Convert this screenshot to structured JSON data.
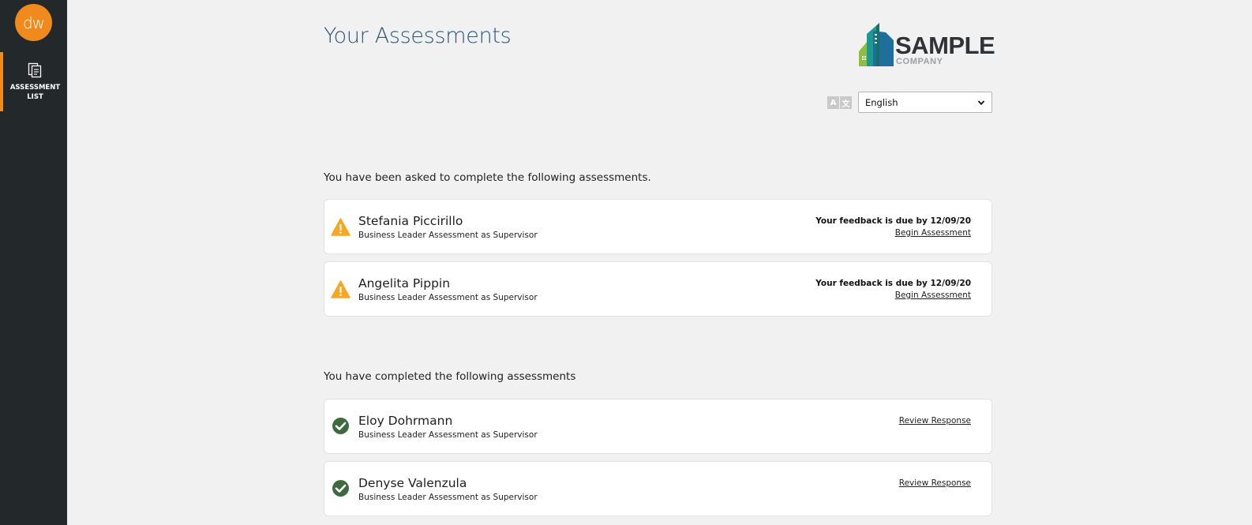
{
  "sidebar": {
    "logo_text": "dw",
    "nav": [
      {
        "label": "ASSESSMENT LIST",
        "icon": "assessment-list-icon",
        "active": true
      }
    ]
  },
  "header": {
    "title": "Your Assessments",
    "company_logo": {
      "line1": "SAMPLE",
      "line2": "COMPANY"
    },
    "translate_icon_glyphs": [
      "A",
      "文"
    ],
    "language": {
      "selected": "English"
    }
  },
  "pending": {
    "heading": "You have been asked to complete the following assessments.",
    "items": [
      {
        "name": "Stefania Piccirillo",
        "type": "Business Leader Assessment as Supervisor",
        "due": "Your feedback is due by 12/09/20",
        "action": "Begin Assessment"
      },
      {
        "name": "Angelita Pippin",
        "type": "Business Leader Assessment as Supervisor",
        "due": "Your feedback is due by 12/09/20",
        "action": "Begin Assessment"
      }
    ]
  },
  "completed": {
    "heading": "You have completed the following assessments",
    "items": [
      {
        "name": "Eloy Dohrmann",
        "type": "Business Leader Assessment as Supervisor",
        "action": "Review Response"
      },
      {
        "name": "Denyse Valenzula",
        "type": "Business Leader Assessment as Supervisor",
        "action": "Review Response"
      }
    ]
  },
  "colors": {
    "sidebar_bg": "#23282b",
    "accent": "#f08a1c",
    "title": "#2a5678",
    "warning": "#f5a623",
    "success": "#3d6b3f"
  }
}
